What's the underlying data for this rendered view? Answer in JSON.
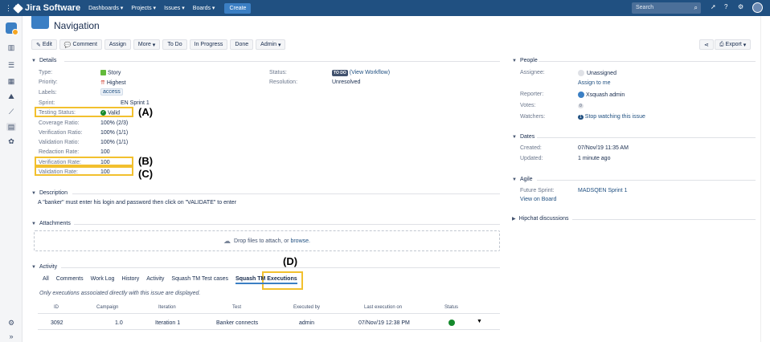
{
  "header": {
    "product": "Jira Software",
    "nav": [
      "Dashboards",
      "Projects",
      "Issues",
      "Boards"
    ],
    "create_label": "Create",
    "search_placeholder": "Search"
  },
  "issue": {
    "title": "Navigation"
  },
  "toolbar": {
    "edit": "Edit",
    "comment": "Comment",
    "assign": "Assign",
    "more": "More",
    "todo": "To Do",
    "inprogress": "In Progress",
    "done": "Done",
    "admin": "Admin",
    "export": "Export"
  },
  "details": {
    "heading": "Details",
    "type_label": "Type:",
    "type_value": "Story",
    "priority_label": "Priority:",
    "priority_value": "Highest",
    "labels_label": "Labels:",
    "labels_value": "access",
    "sprint_label": "Sprint:",
    "sprint_value": "EN Sprint 1",
    "testing_label": "Testing Status:",
    "testing_value": "Valid",
    "coverage_label": "Coverage Ratio:",
    "coverage_value": "100% (2/3)",
    "verification_ratio_label": "Verification Ratio:",
    "verification_ratio_value": "100% (1/1)",
    "validation_ratio_label": "Validation Ratio:",
    "validation_ratio_value": "100% (1/1)",
    "redaction_label": "Redaction Rate:",
    "redaction_value": "100",
    "verification_rate_label": "Verification Rate:",
    "verification_rate_value": "100",
    "validation_rate_label": "Validation Rate:",
    "validation_rate_value": "100",
    "status_label": "Status:",
    "status_value": "TO DO",
    "status_link": "(View Workflow)",
    "resolution_label": "Resolution:",
    "resolution_value": "Unresolved"
  },
  "annotations": {
    "a": "(A)",
    "b": "(B)",
    "c": "(C)",
    "d": "(D)"
  },
  "description": {
    "heading": "Description",
    "text": "A \"banker\" must enter his login and password then click on \"VALIDATE\" to enter"
  },
  "attachments": {
    "heading": "Attachments",
    "drop_text": "Drop files to attach, or",
    "browse": "browse."
  },
  "activity": {
    "heading": "Activity",
    "tabs": [
      "All",
      "Comments",
      "Work Log",
      "History",
      "Activity",
      "Squash TM Test cases",
      "Squash TM Executions"
    ],
    "note": "Only executions associated directly with this issue are displayed.",
    "columns": [
      "ID",
      "Campaign",
      "Iteration",
      "Test",
      "Executed by",
      "Last execution on",
      "Status"
    ],
    "rows": [
      {
        "id": "3092",
        "campaign": "1.0",
        "iteration": "Iteration 1",
        "test": "Banker connects",
        "executed_by": "admin",
        "last_exec": "07/Nov/19 12:38 PM"
      }
    ]
  },
  "people": {
    "heading": "People",
    "assignee_label": "Assignee:",
    "assignee_value": "Unassigned",
    "assign_to_me": "Assign to me",
    "reporter_label": "Reporter:",
    "reporter_value": "Xsquash admin",
    "votes_label": "Votes:",
    "votes_value": "0",
    "watchers_label": "Watchers:",
    "watchers_value": "1",
    "watch_link": "Stop watching this issue"
  },
  "dates": {
    "heading": "Dates",
    "created_label": "Created:",
    "created_value": "07/Nov/19 11:35 AM",
    "updated_label": "Updated:",
    "updated_value": "1 minute ago"
  },
  "agile": {
    "heading": "Agile",
    "future_label": "Future Sprint:",
    "future_value": "MADSQEN Sprint 1",
    "view_board": "View on Board"
  },
  "hipchat": {
    "heading": "Hipchat discussions"
  },
  "colors": {
    "header": "#205081",
    "highlight": "#f2c02e",
    "link": "#205081"
  }
}
